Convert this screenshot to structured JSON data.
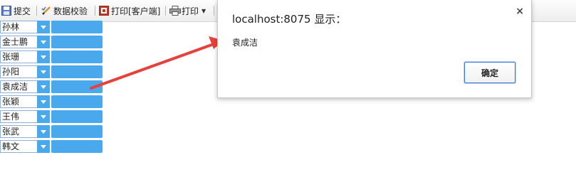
{
  "toolbar": {
    "items": [
      {
        "label": "提交",
        "icon": "save-icon"
      },
      {
        "label": "数据校验",
        "icon": "pencil-check-icon"
      },
      {
        "label": "打印[客户端]",
        "icon": "print-client-icon"
      },
      {
        "label": "打印",
        "icon": "printer-icon",
        "has_dropdown": true
      }
    ]
  },
  "rows": [
    {
      "name": "孙林"
    },
    {
      "name": "金士鹏"
    },
    {
      "name": "张珊"
    },
    {
      "name": "孙阳"
    },
    {
      "name": "袁成洁"
    },
    {
      "name": "张颖"
    },
    {
      "name": "王伟"
    },
    {
      "name": "张武"
    },
    {
      "name": "韩文"
    }
  ],
  "dialog": {
    "title": "localhost:8075 显示：",
    "message": "袁成洁",
    "ok_label": "确定",
    "close_glyph": "×"
  },
  "colors": {
    "accent_blue": "#4aa9ec",
    "arrow_red": "#e8413c",
    "button_border": "#3b7bd6"
  }
}
